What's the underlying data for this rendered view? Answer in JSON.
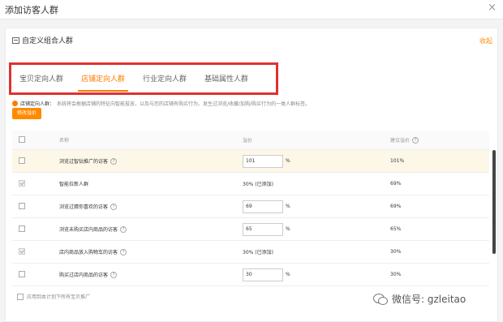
{
  "dialog": {
    "title": "添加访客人群",
    "close": "×"
  },
  "panel": {
    "title": "自定义组合人群",
    "collapse": "收起"
  },
  "tabs": [
    {
      "label": "宝贝定向人群"
    },
    {
      "label": "店铺定向人群"
    },
    {
      "label": "行业定向人群"
    },
    {
      "label": "基础属性人群"
    }
  ],
  "info": {
    "label": "店铺定向人群：",
    "text": "系统将会根据店铺的特征向智能投放，以及与您的店铺有购买行为、发生过浏览/收藏/加购/购买行为的一类人群标签。"
  },
  "bulk_button": "修改溢价",
  "table": {
    "headers": {
      "name": "名称",
      "bid": "溢价",
      "suggest": "建议溢价"
    },
    "unit": "%",
    "rows": [
      {
        "name": "浏览过智钻推广的访客",
        "bid": "101",
        "suggest": "101%"
      },
      {
        "name": "智能拉新人群",
        "bid": "30% (已添加)",
        "suggest": "69%"
      },
      {
        "name": "浏览过猜你喜欢的访客",
        "bid": "69",
        "suggest": "69%"
      },
      {
        "name": "浏览未购买店内商品的访客",
        "bid": "65",
        "suggest": "65%"
      },
      {
        "name": "店内商品放入购物车的访客",
        "bid": "30% (已添加)",
        "suggest": "30%"
      },
      {
        "name": "购买过店内商品的访客",
        "bid": "30",
        "suggest": "30%"
      }
    ]
  },
  "footer": {
    "label": "应用到本计划下所有宝贝推广"
  },
  "watermark": {
    "text": "微信号: gzleitao"
  },
  "colors": {
    "accent": "#ff7a00",
    "highlight": "#e03030"
  }
}
